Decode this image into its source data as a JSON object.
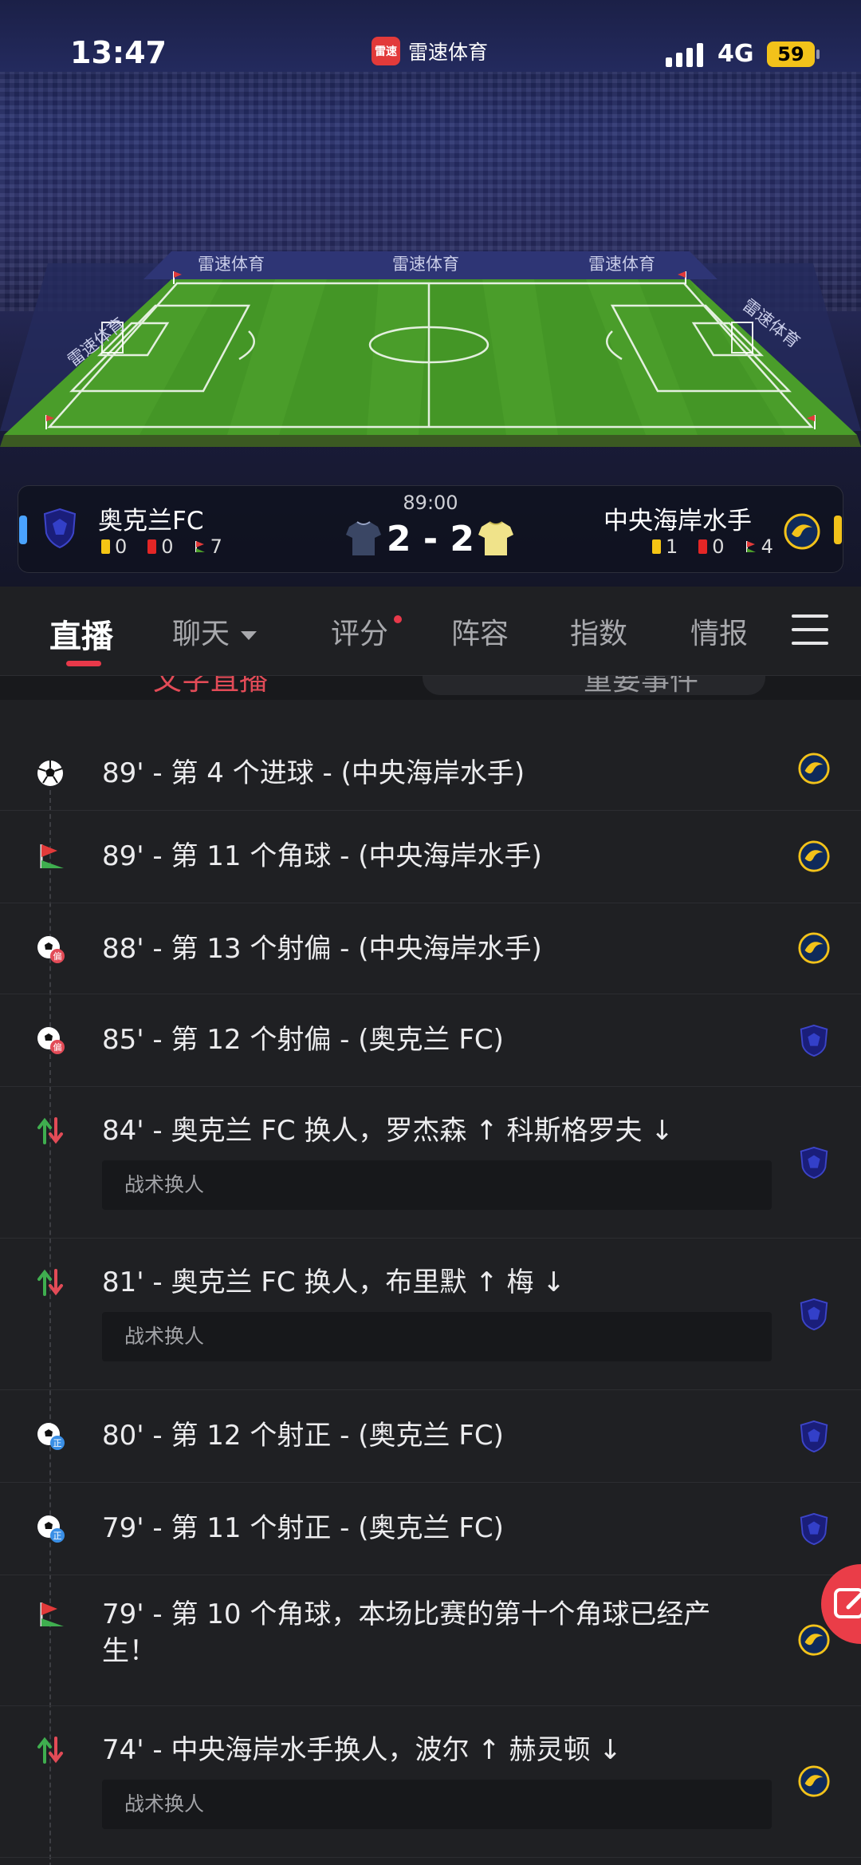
{
  "status_bar": {
    "time": "13:47",
    "app_logo_text": "雷速",
    "app_name": "雷速体育",
    "network": "4G",
    "battery": "59"
  },
  "stadium": {
    "banners": [
      "雷速体育",
      "雷速体育",
      "雷速体育",
      "雷速体育",
      "雷速体育"
    ]
  },
  "match": {
    "time": "89:00",
    "score": "2 - 2",
    "home": {
      "name": "奥克兰FC",
      "yellow": "0",
      "red": "0",
      "corners": "7"
    },
    "away": {
      "name": "中央海岸水手",
      "yellow": "1",
      "red": "0",
      "corners": "4"
    }
  },
  "tabs": {
    "live": "直播",
    "chat": "聊天",
    "rating": "评分",
    "lineup": "阵容",
    "index": "指数",
    "intel": "情报"
  },
  "subtabs": {
    "left": "文字直播",
    "right": "重要事件"
  },
  "events": [
    {
      "text": "89' - 第 4 个进球 - (中央海岸水手)",
      "icon": "goal-icon",
      "team": "away"
    },
    {
      "text": "89' - 第 11 个角球 - (中央海岸水手)",
      "icon": "corner-icon",
      "team": "away"
    },
    {
      "text": "88' - 第 13 个射偏 - (中央海岸水手)",
      "icon": "shot-off-target-icon",
      "team": "away"
    },
    {
      "text": "85' - 第 12 个射偏 - (奥克兰 FC)",
      "icon": "shot-off-target-icon",
      "team": "home"
    },
    {
      "text": "84' - 奥克兰 FC 换人，罗杰森 ↑ 科斯格罗夫 ↓",
      "note": "战术换人",
      "icon": "substitution-icon",
      "team": "home"
    },
    {
      "text": "81' - 奥克兰 FC 换人，布里默 ↑ 梅 ↓",
      "note": "战术换人",
      "icon": "substitution-icon",
      "team": "home"
    },
    {
      "text": "80' - 第 12 个射正 - (奥克兰 FC)",
      "icon": "shot-on-target-icon",
      "team": "home"
    },
    {
      "text": "79' - 第 11 个射正 - (奥克兰 FC)",
      "icon": "shot-on-target-icon",
      "team": "home"
    },
    {
      "text": "79' - 第 10 个角球，本场比赛的第十个角球已经产生！",
      "icon": "corner-icon",
      "team": "away"
    },
    {
      "text": "74' - 中央海岸水手换人，波尔 ↑ 赫灵顿 ↓",
      "note": "战术换人",
      "icon": "substitution-icon",
      "team": "away"
    }
  ],
  "icon_labels": {
    "shot_off": "偏",
    "shot_on": "正"
  },
  "colors": {
    "accent": "#e8394a",
    "home": "#4aa3ff",
    "away": "#f2c21a",
    "background": "#1f2023"
  }
}
